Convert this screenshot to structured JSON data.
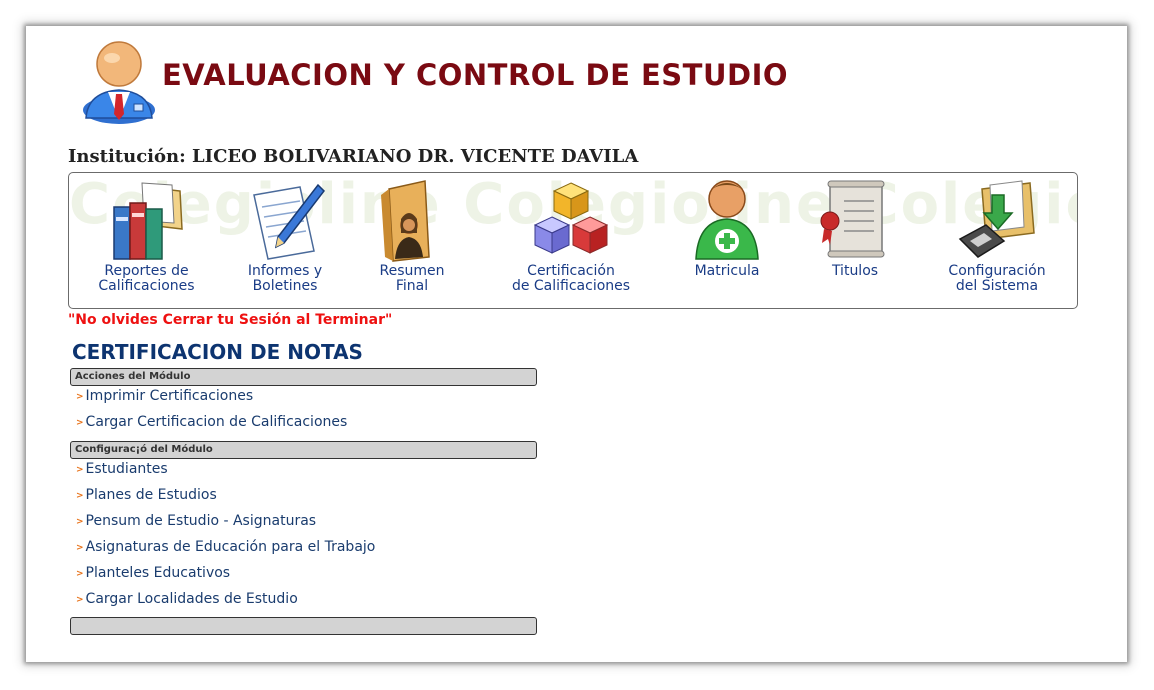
{
  "header": {
    "title": "EVALUACION Y CONTROL DE ESTUDIO",
    "institution": "Institución: LICEO BOLIVARIANO DR. VICENTE DAVILA"
  },
  "toolbar": {
    "watermark": "Colegioline  Colegioline  Colegio",
    "items": [
      {
        "label": "Reportes de\nCalificaciones",
        "icon": "books-icon"
      },
      {
        "label": "Informes y\nBoletines",
        "icon": "notepad-pen-icon"
      },
      {
        "label": "Resumen\nFinal",
        "icon": "folder-person-icon"
      },
      {
        "label": "Certificación\nde Calificaciones",
        "icon": "cubes-icon"
      },
      {
        "label": "Matricula",
        "icon": "user-add-icon"
      },
      {
        "label": "Titulos",
        "icon": "diploma-icon"
      },
      {
        "label": "Configuración\ndel Sistema",
        "icon": "folder-disk-icon"
      }
    ]
  },
  "warning": "\"No olvides Cerrar tu Sesión al Terminar\"",
  "module": {
    "title": "CERTIFICACION DE NOTAS",
    "actions_header": "Acciones del Módulo",
    "actions": [
      "Imprimir Certificaciones",
      "Cargar Certificacion de Calificaciones"
    ],
    "config_header": "Configurac¡ó del Módulo",
    "config": [
      "Estudiantes",
      "Planes de Estudios",
      "Pensum de Estudio - Asignaturas",
      "Asignaturas de Educación para el Trabajo",
      "Planteles Educativos",
      "Cargar Localidades de Estudio"
    ],
    "footer_bar": ""
  },
  "colors": {
    "title": "#7a0a12",
    "link": "#1a3c6e",
    "warning": "#ee1111",
    "section": "#0d3470",
    "bar": "#d3d3d3"
  }
}
